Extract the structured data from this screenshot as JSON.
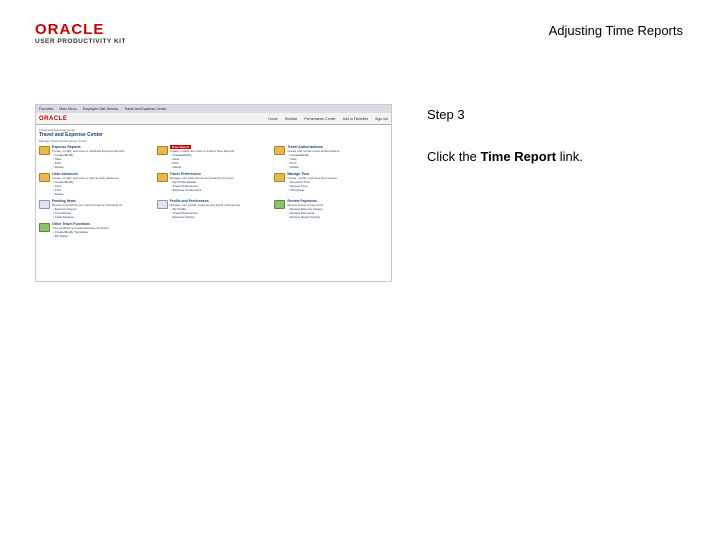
{
  "header": {
    "logo_brand": "ORACLE",
    "logo_product": "USER PRODUCTIVITY KIT",
    "doc_title": "Adjusting Time Reports"
  },
  "instructions": {
    "step": "Step 3",
    "text_before": "Click the ",
    "bold": "Time Report",
    "text_after": " link."
  },
  "screenshot": {
    "topnav": [
      "Favorites",
      "Main Menu",
      "Employee Self-Service",
      "Travel and Expense Center"
    ],
    "brand": "ORACLE",
    "mainnav": [
      "Home",
      "Worklist",
      "Performance Center",
      "Add to Favorites",
      "Sign out"
    ],
    "crumb": "Travel and Expense Center",
    "page_title": "Travel and Expense Center",
    "page_sub": "Manage Travel and Expense Center",
    "cards": [
      {
        "title": "Expense Reports",
        "desc": "Create, modify, and view or withdraw Expense Reports",
        "links": [
          "Create/Modify",
          "View",
          "Print",
          "Delete"
        ],
        "icon": "folder"
      },
      {
        "title": "Time Report",
        "desc": "Create, modify, and view or submit Time Reports",
        "links": [
          "Create/Modify",
          "View",
          "Print",
          "Delete"
        ],
        "icon": "folder",
        "highlight": true
      },
      {
        "title": "Travel Authorizations",
        "desc": "Create and review travel authorizations",
        "links": [
          "Create/Modify",
          "View",
          "Print",
          "Delete"
        ],
        "icon": "folder"
      },
      {
        "title": "Cash Advances",
        "desc": "Create, modify, and view or submit cash advances",
        "links": [
          "Create/Modify",
          "View",
          "Print",
          "Delete"
        ],
        "icon": "folder"
      },
      {
        "title": "Travel Preferences",
        "desc": "Manage your preferences and defaults for travel",
        "links": [
          "My Profile Details",
          "Travel Preferences",
          "Expense Preferences"
        ],
        "icon": "folder"
      },
      {
        "title": "Manage Time",
        "desc": "Create, modify, and view time reports",
        "links": [
          "Reported Time",
          "Review Time",
          "Timesheet"
        ],
        "icon": "folder"
      },
      {
        "title": "Pending Items",
        "desc": "Review and submit your saved expense transactions",
        "links": [
          "Expense Report",
          "Time Report",
          "Cash Advance"
        ],
        "icon": "doc"
      },
      {
        "title": "Profile and Preferences",
        "desc": "Manage your profile, expense and travel preferences",
        "links": [
          "My Profile",
          "Travel Preferences",
          "Expense Activity"
        ],
        "icon": "doc"
      },
      {
        "title": "Review Payments",
        "desc": "Review status of payments",
        "links": [
          "Review Expense History",
          "Review Payments",
          "Review Report Activity"
        ],
        "icon": "green"
      },
      {
        "title": "Other Travel Functions",
        "desc": "Your workflow and administrative functions",
        "links": [
          "Create/Modify Templates",
          "My Wallet"
        ],
        "icon": "green"
      }
    ]
  }
}
